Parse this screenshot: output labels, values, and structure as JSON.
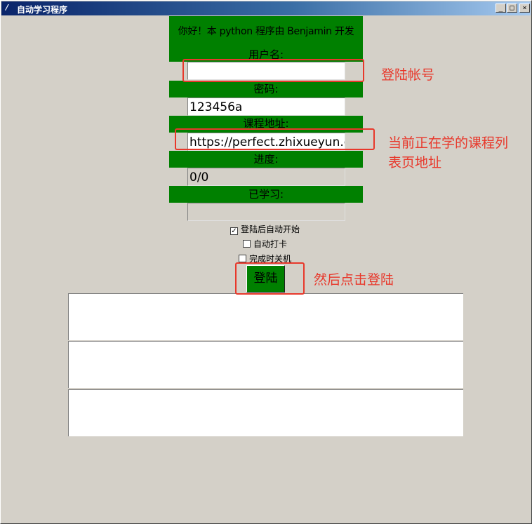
{
  "window": {
    "title": "自动学习程序",
    "icon": "feather-icon",
    "controls": {
      "minimize": "_",
      "maximize": "□",
      "close": "×"
    }
  },
  "form": {
    "greeting": "你好！本 python 程序由 Benjamin 开发",
    "username_label": "用户名:",
    "username_value": "",
    "password_label": "密码:",
    "password_value": "123456a",
    "course_url_label": "课程地址:",
    "course_url_value": "https://perfect.zhixueyun.co",
    "progress_label": "进度:",
    "progress_value": "0/0",
    "learned_label": "已学习:",
    "learned_value": ""
  },
  "options": [
    {
      "label": "登陆后自动开始",
      "checked": true
    },
    {
      "label": "自动打卡",
      "checked": false
    },
    {
      "label": "完成时关机",
      "checked": false
    }
  ],
  "login_button": "登陆",
  "annotations": {
    "account": "登陆帐号",
    "course_line1": "当前正在学的课程列",
    "course_line2": "表页地址",
    "click_login": "然后点击登陆",
    "color": "#e8382b"
  },
  "colors": {
    "green": "#008000",
    "window_bg": "#d4d0c8"
  }
}
